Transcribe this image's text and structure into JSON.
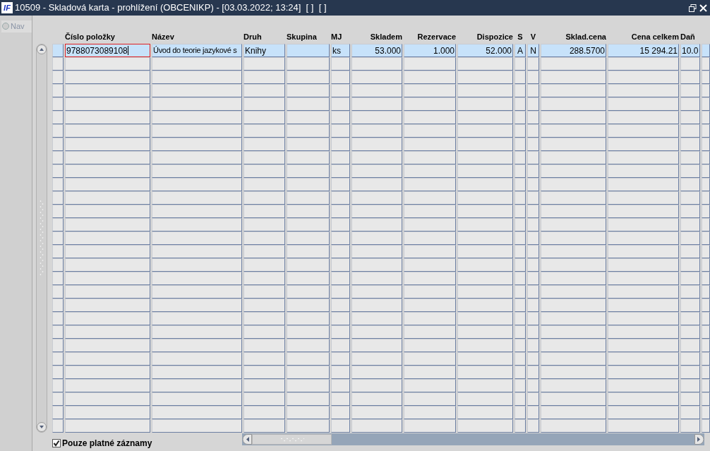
{
  "window": {
    "logo": "IF",
    "title": "10509 - Skladová karta - prohlížení (OBCENIKP) - [03.03.2022; 13:24]  [ ]  [ ]"
  },
  "nav": {
    "label": "Nav",
    "selected": false,
    "disabled": true
  },
  "table": {
    "columns": [
      {},
      {
        "label": "Číslo položky"
      },
      {
        "label": "Název"
      },
      {
        "label": "Druh"
      },
      {
        "label": "Skupina"
      },
      {
        "label": "MJ"
      },
      {
        "label": "Skladem"
      },
      {
        "label": "Rezervace"
      },
      {
        "label": "Dispozice"
      },
      {
        "label": "S"
      },
      {
        "label": "V"
      },
      {
        "label": "Sklad.cena"
      },
      {
        "label": "Cena celkem"
      },
      {
        "label": "Daň"
      },
      {}
    ],
    "rows": [
      {
        "selected": true,
        "cells": [
          {
            "focused": false
          },
          {
            "text": "9788073089108",
            "focused": true
          },
          {
            "text": "Úvod do teorie jazykové s",
            "focused": false
          },
          {
            "text": "Knihy",
            "focused": false
          },
          {
            "focused": false
          },
          {
            "text": "ks",
            "focused": false
          },
          {
            "text": "53.000",
            "focused": false
          },
          {
            "text": "1.000",
            "focused": false
          },
          {
            "text": "52.000",
            "focused": false
          },
          {
            "text": "A",
            "focused": false
          },
          {
            "text": "N",
            "focused": false
          },
          {
            "text": "288.5700",
            "focused": false
          },
          {
            "text": "15 294.21",
            "focused": false
          },
          {
            "text": "10.0",
            "focused": false
          },
          {
            "focused": false
          }
        ]
      }
    ]
  },
  "filter": {
    "label": "Pouze platné záznamy",
    "checked": true
  }
}
